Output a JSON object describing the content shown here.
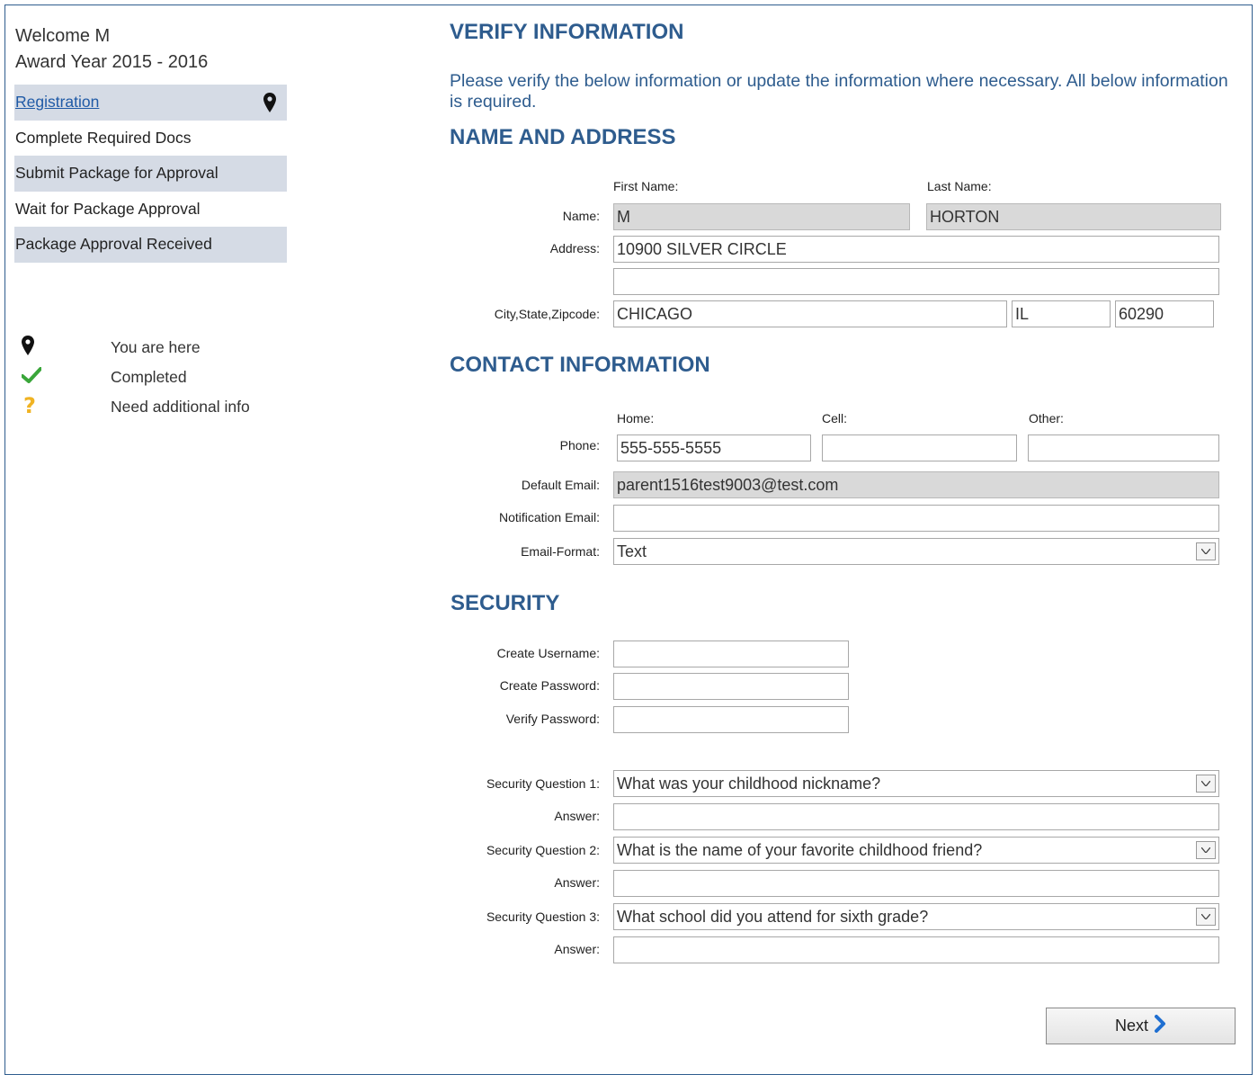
{
  "sidebar": {
    "welcome": "Welcome M",
    "award_year": "Award Year 2015 - 2016",
    "steps": [
      {
        "label": "Registration"
      },
      {
        "label": "Complete Required Docs"
      },
      {
        "label": "Submit Package for Approval"
      },
      {
        "label": "Wait for Package Approval"
      },
      {
        "label": "Package Approval Received"
      }
    ],
    "legend": [
      {
        "icon": "map-pin-icon",
        "label": "You are here"
      },
      {
        "icon": "checkmark-icon",
        "label": "Completed"
      },
      {
        "icon": "question-mark-icon",
        "label": "Need additional info"
      }
    ]
  },
  "main": {
    "title": "VERIFY INFORMATION",
    "intro": "Please verify the below information or update the information where necessary. All below information is required.",
    "name_address": {
      "heading": "NAME AND ADDRESS",
      "first_name_label": "First Name:",
      "last_name_label": "Last Name:",
      "name_label": "Name:",
      "first_name": "M",
      "last_name": "HORTON",
      "address_label": "Address:",
      "address1": "10900 SILVER CIRCLE",
      "address2": "",
      "city_label": "City,State,Zipcode:",
      "city": "CHICAGO",
      "state": "IL",
      "zip": "60290"
    },
    "contact": {
      "heading": "CONTACT INFORMATION",
      "home_label": "Home:",
      "cell_label": "Cell:",
      "other_label": "Other:",
      "phone_label": "Phone:",
      "home_phone": "555-555-5555",
      "cell_phone": "",
      "other_phone": "",
      "default_email_label": "Default Email:",
      "default_email": "parent1516test9003@test.com",
      "notification_email_label": "Notification Email:",
      "notification_email": "",
      "email_format_label": "Email-Format:",
      "email_format": "Text"
    },
    "security": {
      "heading": "SECURITY",
      "username_label": "Create Username:",
      "password_label": "Create Password:",
      "verify_label": "Verify Password:",
      "q1_label": "Security Question 1:",
      "q1": "What was your childhood nickname?",
      "q2_label": "Security Question 2:",
      "q2": "What is the name of your favorite childhood friend?",
      "q3_label": "Security Question 3:",
      "q3": "What school did you attend for sixth grade?",
      "answer_label": "Answer:"
    },
    "next_label": "Next"
  },
  "colors": {
    "heading": "#2e5c8e",
    "step_bg": "#d5dbe5",
    "readonly_bg": "#d9d9d9",
    "accent": "#1f6fd1",
    "check": "#3aa63a",
    "question": "#f0b323"
  }
}
